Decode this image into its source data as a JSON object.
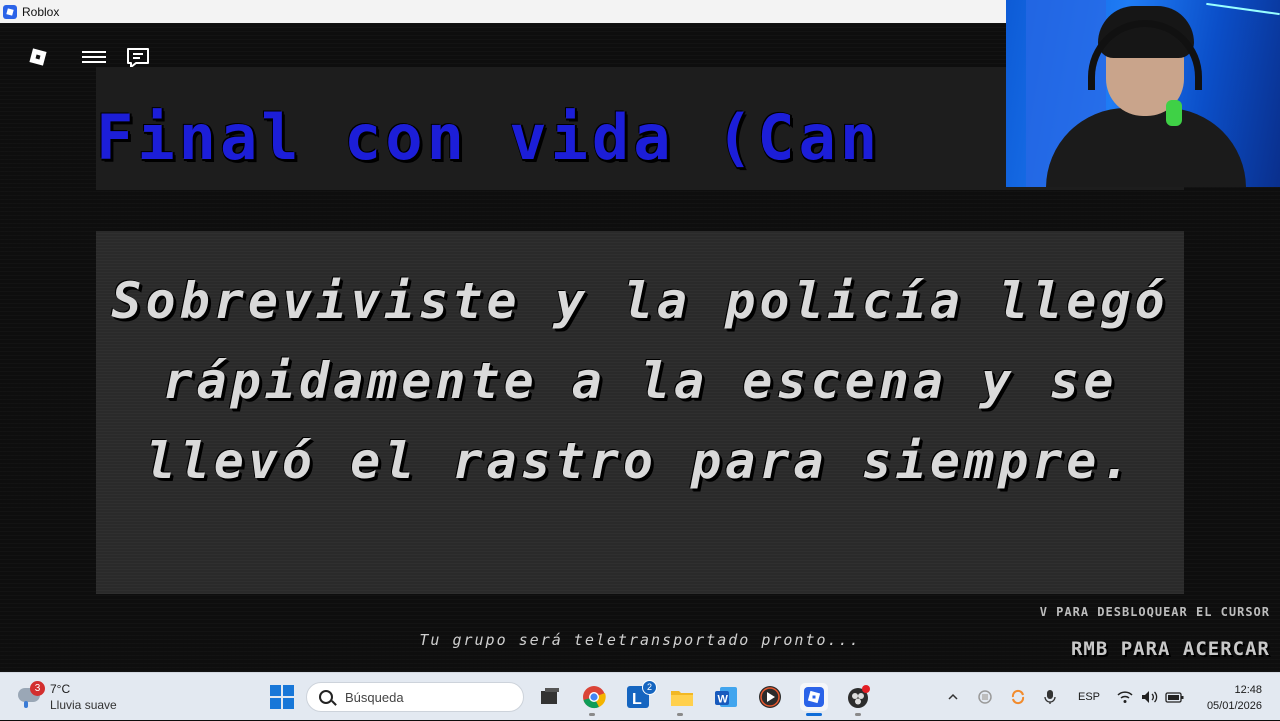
{
  "window": {
    "title": "Roblox"
  },
  "game": {
    "title_banner": "Final con vida (Can",
    "ending_message": "Sobreviviste y la policía llegó rápidamente a la escena y se llevó el rastro para siempre.",
    "unlock_cursor_hint": "V PARA DESBLOQUEAR EL CURSOR",
    "teleport_message": "Tu grupo será teletransportado pronto...",
    "zoom_hint": "RMB PARA ACERCAR"
  },
  "taskbar": {
    "weather": {
      "temperature": "7°C",
      "condition": "Lluvia suave",
      "badge_count": "3"
    },
    "search_placeholder": "Búsqueda",
    "launcher_badge": "2",
    "language": "ESP",
    "time": "12:48",
    "date": "05/01/2026"
  },
  "colors": {
    "title_blue": "#1c1ed8",
    "taskbar_bg": "#e3e9f1",
    "accent": "#0f6cd8"
  }
}
